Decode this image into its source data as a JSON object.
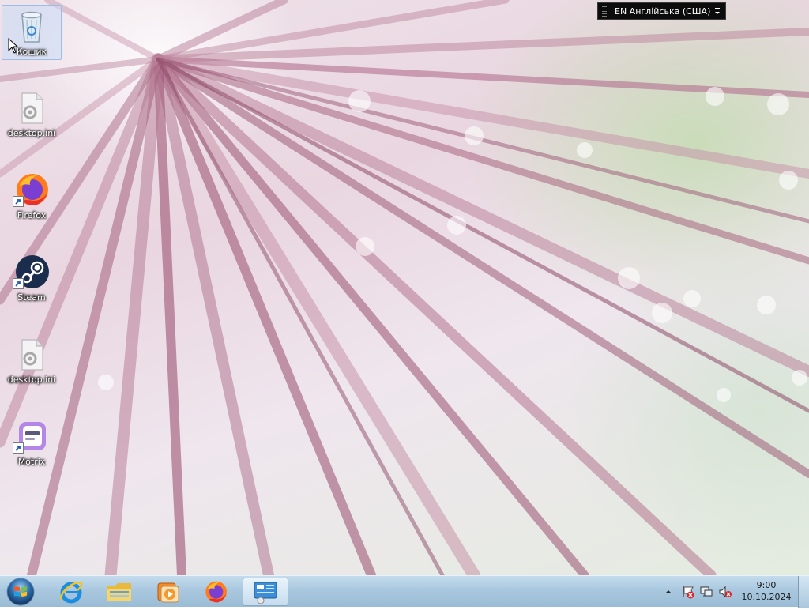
{
  "desktop": {
    "icons": [
      {
        "label": "Кошик",
        "icon": "recycle-bin-icon",
        "selected": true
      },
      {
        "label": "desktop.ini",
        "icon": "settings-file-icon"
      },
      {
        "label": "Firefox",
        "icon": "firefox-icon",
        "shortcut": true
      },
      {
        "label": "Steam",
        "icon": "steam-icon",
        "shortcut": true
      },
      {
        "label": "desktop.ini",
        "icon": "settings-file-icon"
      },
      {
        "label": "Motrix",
        "icon": "motrix-icon",
        "shortcut": true
      }
    ]
  },
  "language_bar": {
    "text": "EN Англійська (США)"
  },
  "taskbar": {
    "start_icon": "windows-start-icon",
    "pinned": [
      {
        "icon": "internet-explorer-icon"
      },
      {
        "icon": "file-explorer-icon"
      },
      {
        "icon": "media-player-icon"
      },
      {
        "icon": "firefox-icon"
      },
      {
        "icon": "remote-desktop-icon",
        "active": true
      }
    ],
    "tray_icons": [
      "show-hidden-icons-chevron",
      "action-center-icon",
      "network-icon",
      "volume-muted-icon"
    ]
  },
  "clock": {
    "time": "9:00",
    "date": "10.10.2024"
  },
  "colors": {
    "taskbar": "#a9c8df",
    "ray": "#b0708a",
    "label_text": "#ffffff"
  }
}
